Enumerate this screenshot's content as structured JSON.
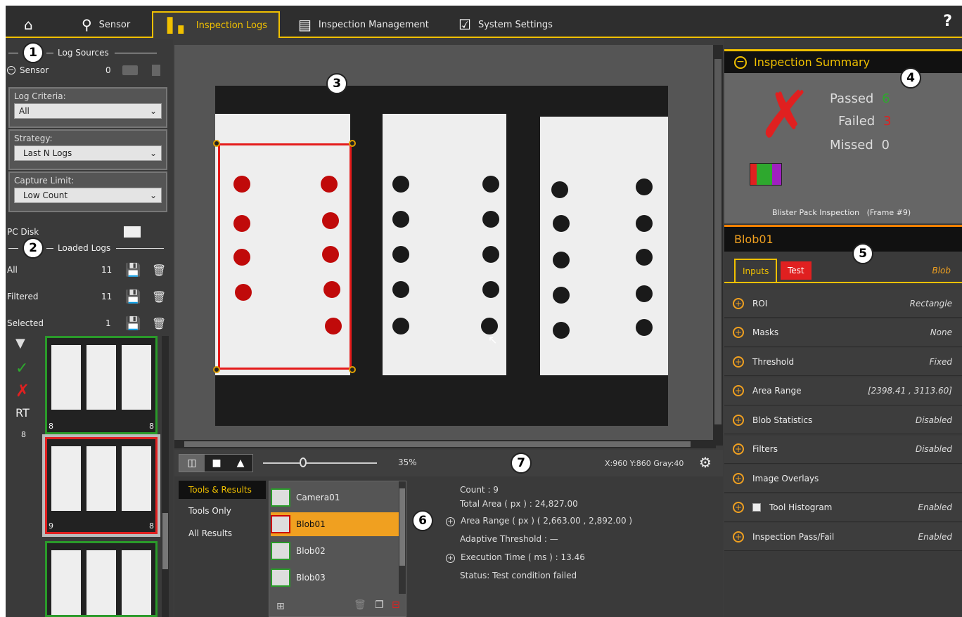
{
  "nav": {
    "tabs": [
      {
        "label": "",
        "icon": "home-icon"
      },
      {
        "label": "Sensor",
        "icon": "sensor-icon"
      },
      {
        "label": "Inspection Logs",
        "icon": "inspection-logs-icon"
      },
      {
        "label": "Inspection Management",
        "icon": "list-icon"
      },
      {
        "label": "System Settings",
        "icon": "settings-check-icon"
      }
    ],
    "help": "?"
  },
  "callouts": [
    "1",
    "2",
    "3",
    "4",
    "5",
    "6",
    "7"
  ],
  "log_sources": {
    "title": "Log Sources",
    "sensor_label": "Sensor",
    "sensor_count": "0",
    "criteria_label": "Log Criteria:",
    "criteria_value": "All",
    "strategy_label": "Strategy:",
    "strategy_value": "Last N Logs",
    "capture_label": "Capture Limit:",
    "capture_value": "Low Count",
    "pc_disk": "PC Disk"
  },
  "loaded_logs": {
    "title": "Loaded Logs",
    "rows": [
      {
        "label": "All",
        "count": "11"
      },
      {
        "label": "Filtered",
        "count": "11"
      },
      {
        "label": "Selected",
        "count": "1"
      }
    ],
    "rt_label": "RT",
    "count_label": "8",
    "thumbs": [
      {
        "left": "8",
        "right": "8",
        "status": "pass"
      },
      {
        "left": "9",
        "right": "8",
        "status": "fail"
      },
      {
        "left": "",
        "right": "",
        "status": "pass"
      }
    ]
  },
  "viewer": {
    "zoom": "35%",
    "zoom_fraction": 0.35,
    "coords": "X:960 Y:860 Gray:40"
  },
  "results_tabs": [
    "Tools & Results",
    "Tools Only",
    "All Results"
  ],
  "tools": [
    "Camera01",
    "Blob01",
    "Blob02",
    "Blob03"
  ],
  "results": {
    "count": "Count :  9",
    "total_area": "Total Area ( px ) :  24,827.00",
    "area_range": "Area Range ( px ) ( 2,663.00 , 2,892.00 )",
    "adaptive": "Adaptive Threshold : —",
    "exec_time": "Execution Time ( ms ) : 13.46",
    "status": "Status: Test condition failed"
  },
  "summary": {
    "title": "Inspection Summary",
    "passed_label": "Passed",
    "passed": "6",
    "failed_label": "Failed",
    "failed": "3",
    "missed_label": "Missed",
    "missed": "0",
    "caption": "Blister Pack Inspection   (Frame #9)",
    "colors": {
      "passed": "#2ea82e",
      "failed": "#e02020",
      "accent": "#f0c000"
    }
  },
  "tool_panel": {
    "name": "Blob01",
    "tab_inputs": "Inputs",
    "tab_test": "Test",
    "type": "Blob",
    "params": [
      {
        "label": "ROI",
        "value": "Rectangle"
      },
      {
        "label": "Masks",
        "value": "None"
      },
      {
        "label": "Threshold",
        "value": "Fixed"
      },
      {
        "label": "Area Range",
        "value": "[2398.41 , 3113.60]"
      },
      {
        "label": "Blob Statistics",
        "value": "Disabled"
      },
      {
        "label": "Filters",
        "value": "Disabled"
      },
      {
        "label": "Image Overlays",
        "value": ""
      },
      {
        "label": "Tool Histogram",
        "value": "Enabled"
      },
      {
        "label": "Inspection Pass/Fail",
        "value": "Enabled"
      }
    ]
  }
}
